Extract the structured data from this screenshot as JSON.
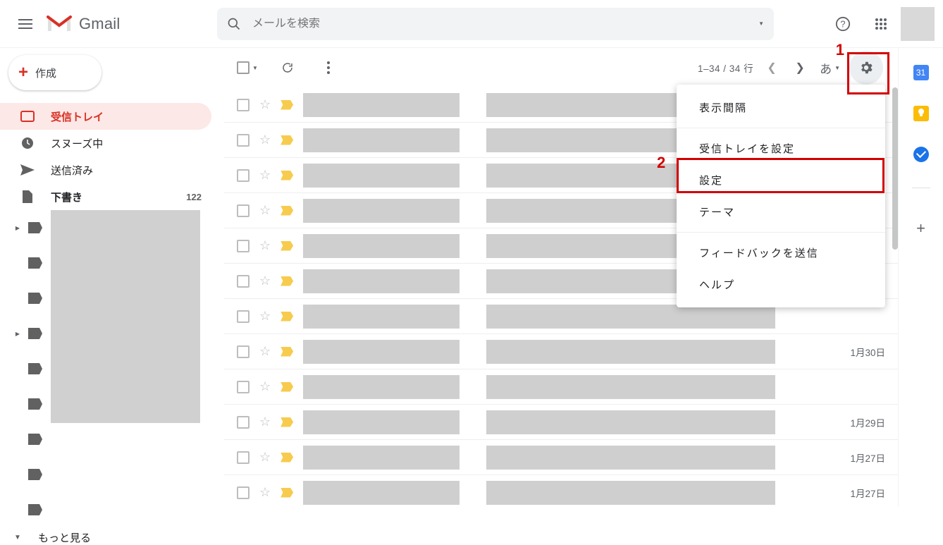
{
  "header": {
    "app_name": "Gmail",
    "search_placeholder": "メールを検索"
  },
  "compose_label": "作成",
  "nav": {
    "inbox": "受信トレイ",
    "snoozed": "スヌーズ中",
    "sent": "送信済み",
    "drafts": "下書き",
    "drafts_count": "122",
    "more": "もっと見る"
  },
  "toolbar": {
    "range": "1–34 / 34 行",
    "lang": "あ"
  },
  "menu": {
    "density": "表示間隔",
    "configure_inbox": "受信トレイを設定",
    "settings": "設定",
    "themes": "テーマ",
    "feedback": "フィードバックを送信",
    "help": "ヘルプ"
  },
  "rows": [
    {
      "date": ""
    },
    {
      "date": ""
    },
    {
      "date": ""
    },
    {
      "date": ""
    },
    {
      "date": ""
    },
    {
      "date": ""
    },
    {
      "date": ""
    },
    {
      "date": "1月30日"
    },
    {
      "date": ""
    },
    {
      "date": "1月29日"
    },
    {
      "date": "1月27日"
    },
    {
      "date": "1月27日"
    }
  ],
  "right_rail": {
    "cal_day": "31"
  },
  "annotations": {
    "one": "1",
    "two": "2"
  }
}
